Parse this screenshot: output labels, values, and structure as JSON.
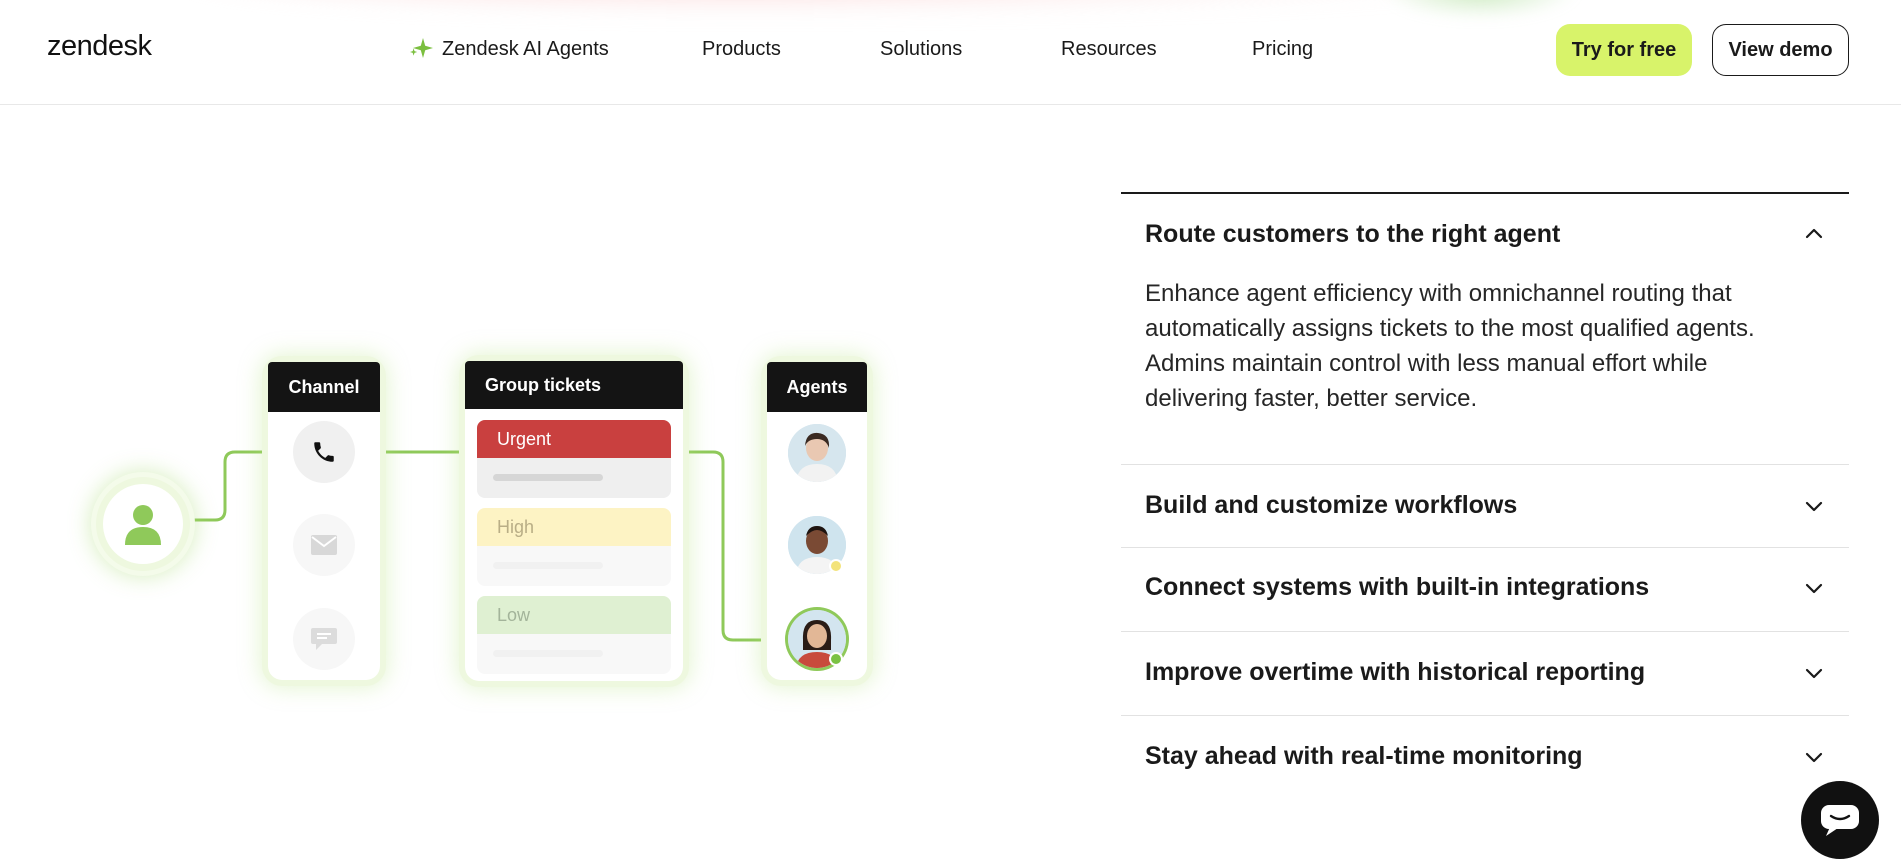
{
  "header": {
    "logo": "zendesk",
    "nav": [
      {
        "label": "Zendesk AI Agents",
        "icon": "sparkle-icon"
      },
      {
        "label": "Products"
      },
      {
        "label": "Solutions"
      },
      {
        "label": "Resources"
      },
      {
        "label": "Pricing"
      }
    ],
    "try_label": "Try for free",
    "demo_label": "View demo"
  },
  "diagram": {
    "channel_title": "Channel",
    "channels": [
      "phone-icon",
      "mail-icon",
      "chat-bubble-icon"
    ],
    "group_title": "Group tickets",
    "priorities": [
      {
        "label": "Urgent",
        "color": "#c9403f",
        "text_color": "#ffffff"
      },
      {
        "label": "High",
        "color": "#fdf3c4",
        "text_color": "#b9ae86"
      },
      {
        "label": "Low",
        "color": "#dff0d2",
        "text_color": "#a3b49a"
      }
    ],
    "agents_title": "Agents",
    "accent_color": "#8fc95a"
  },
  "accordion": {
    "items": [
      {
        "title": "Route customers to the right agent",
        "expanded": true,
        "description": "Enhance agent efficiency with omnichannel routing that automatically assigns tickets to the most qualified agents. Admins maintain control with less manual effort while delivering faster, better service."
      },
      {
        "title": "Build and customize workflows",
        "expanded": false
      },
      {
        "title": "Connect systems with built-in integrations",
        "expanded": false
      },
      {
        "title": "Improve overtime with historical reporting",
        "expanded": false
      },
      {
        "title": "Stay ahead with real-time monitoring",
        "expanded": false
      }
    ]
  },
  "colors": {
    "brand_lime": "#d8f36a",
    "text_dark": "#1a1a1a"
  }
}
